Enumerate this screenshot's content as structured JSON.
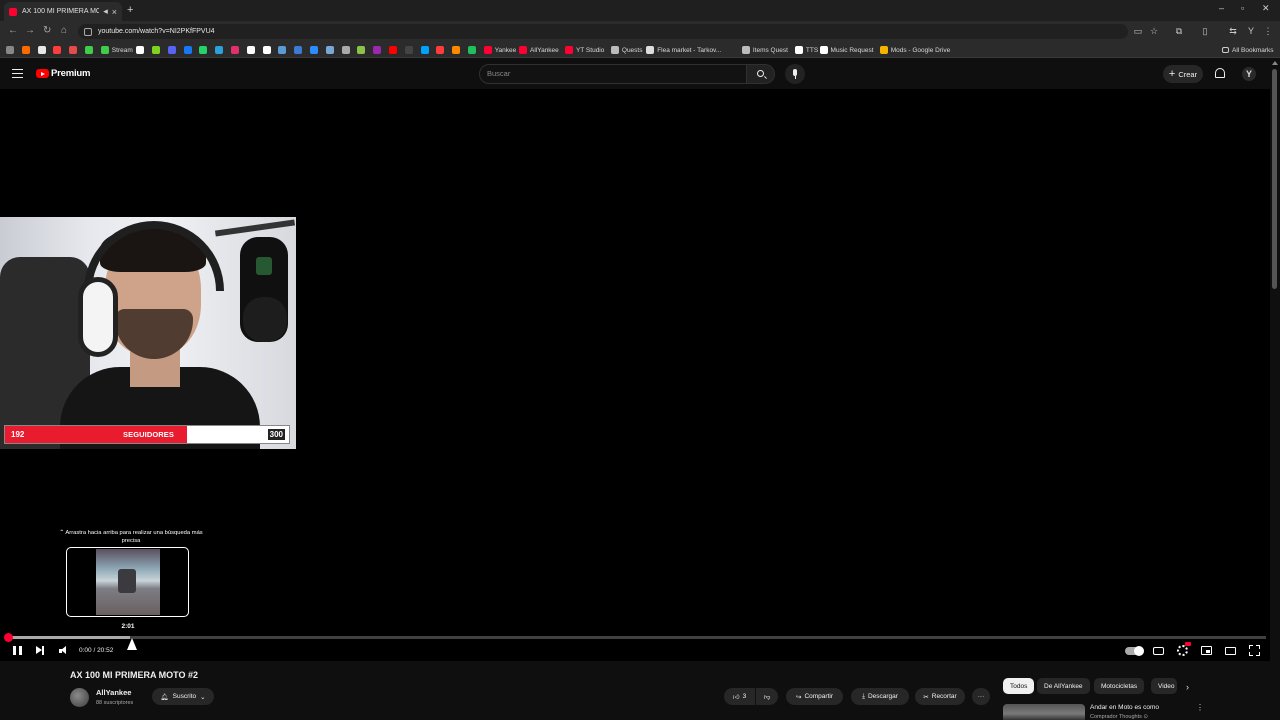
{
  "browser": {
    "tab_title": "AX 100 MI PRIMERA MOTO",
    "new_tab": "+",
    "url": "youtube.com/watch?v=NI2PKfFPVU4",
    "bookmarks": [
      {
        "label": "",
        "color": "#888888"
      },
      {
        "label": "",
        "color": "#ff6a00"
      },
      {
        "label": "",
        "color": "#e8e8e8"
      },
      {
        "label": "",
        "color": "#ff3b3b"
      },
      {
        "label": "",
        "color": "#e54b4b"
      },
      {
        "label": "",
        "color": "#3ecf4a"
      },
      {
        "label": "Stream",
        "color": "#3ecf4a"
      },
      {
        "label": "",
        "color": "#ffffff"
      },
      {
        "label": "",
        "color": "#7ed321"
      },
      {
        "label": "",
        "color": "#5865f2"
      },
      {
        "label": "",
        "color": "#1877f2"
      },
      {
        "label": "",
        "color": "#25d366"
      },
      {
        "label": "",
        "color": "#2aa1da"
      },
      {
        "label": "",
        "color": "#e1306c"
      },
      {
        "label": "",
        "color": "#ffffff"
      },
      {
        "label": "",
        "color": "#ffffff"
      },
      {
        "label": "",
        "color": "#5a9bd5"
      },
      {
        "label": "",
        "color": "#3c7bd4"
      },
      {
        "label": "",
        "color": "#2d8cff"
      },
      {
        "label": "",
        "color": "#7aa7d8"
      },
      {
        "label": "",
        "color": "#aaaaaa"
      },
      {
        "label": "",
        "color": "#8bc34a"
      },
      {
        "label": "",
        "color": "#9c27b0"
      },
      {
        "label": "",
        "color": "#ff0000"
      },
      {
        "label": "",
        "color": "#444444"
      },
      {
        "label": "",
        "color": "#00a2ff"
      },
      {
        "label": "",
        "color": "#ff3b3b"
      },
      {
        "label": "",
        "color": "#ff8800"
      },
      {
        "label": "",
        "color": "#20c05c"
      },
      {
        "label": "Yankee",
        "color": "#ff0033"
      },
      {
        "label": "AllYankee",
        "color": "#ff0033"
      },
      {
        "label": "YT Studio",
        "color": "#ff0033"
      },
      {
        "label": "Quests",
        "color": "#bbbbbb"
      },
      {
        "label": "Flea market - Tarkov...",
        "color": "#dddddd"
      },
      {
        "label": "Items Quest",
        "color": "#bbbbbb"
      },
      {
        "label": "TTS",
        "color": "#ffffff"
      },
      {
        "label": "Music Request",
        "color": "#ffffff"
      },
      {
        "label": "Mods - Google Drive",
        "color": "#f4b400"
      }
    ],
    "all_bookmarks": "All Bookmarks"
  },
  "masthead": {
    "logo_text": "Premium",
    "search_placeholder": "Buscar",
    "create_label": "Crear",
    "avatar_letter": "Y"
  },
  "player": {
    "overlay": {
      "followers_current": "192",
      "followers_label": "SEGUIDORES",
      "followers_goal": "300",
      "followers_progress": 0.64
    },
    "seek_hint": "⌃ Arrastra hacia arriba para realizar una búsqueda más precisa",
    "preview_time": "2:01",
    "time_current": "0:00",
    "time_total": "20:52",
    "time_display": "0:00 / 20:52",
    "played_fraction": 0.0,
    "hover_fraction": 0.097,
    "hd_badge_color": "#ff0033"
  },
  "video": {
    "title": "AX 100 MI PRIMERA MOTO #2",
    "channel": "AllYankee",
    "subscribers": "88 suscriptores",
    "subscribe_label": "Suscrito",
    "likes": "3",
    "share_label": "Compartir",
    "download_label": "Descargar",
    "clip_label": "Recortar",
    "more_label": "···"
  },
  "recommendations": {
    "chips": [
      "Todos",
      "De AllYankee",
      "Motocicletas",
      "Video"
    ],
    "first": {
      "title": "Andar en Moto es como",
      "subtitle": "Comprador Thoughts ⊙"
    }
  }
}
